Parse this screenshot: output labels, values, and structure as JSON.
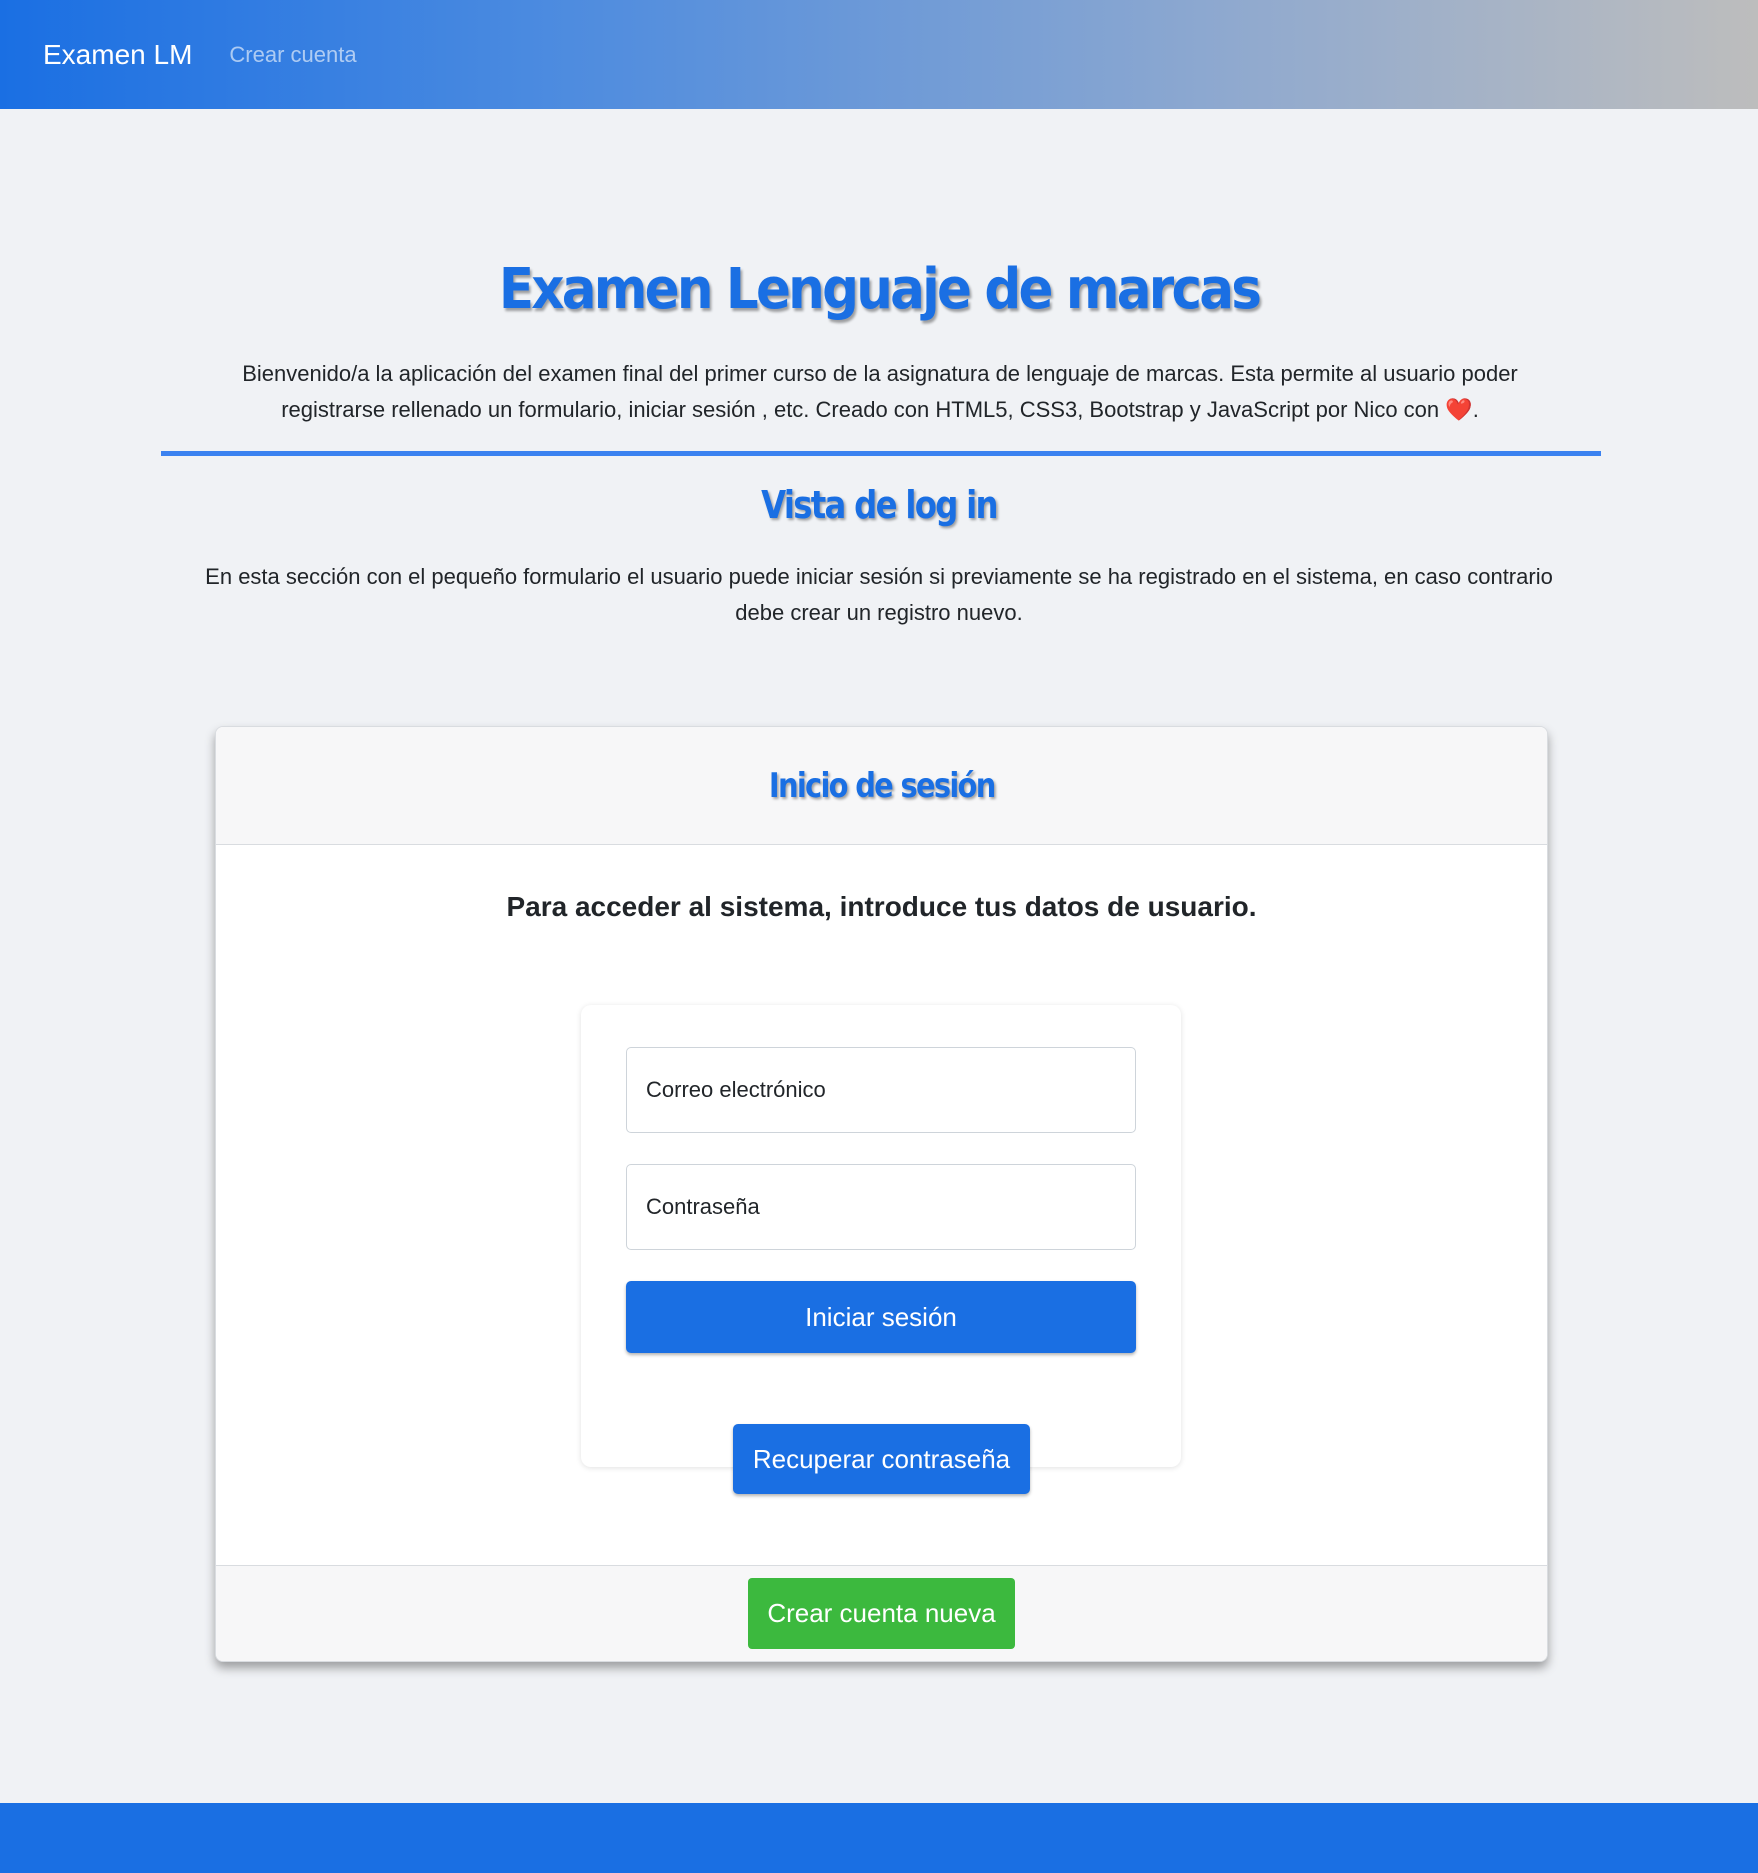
{
  "navbar": {
    "brand": "Examen LM",
    "links": [
      {
        "label": "Crear cuenta"
      }
    ]
  },
  "hero": {
    "title": "Examen Lenguaje de marcas",
    "intro_line1": "Bienvenido/a la aplicación del examen final del primer curso de la asignatura de lenguaje de marcas. Esta permite al usuario poder",
    "intro_line2": "registrarse rellenado un formulario, iniciar sesión , etc. Creado con HTML5, CSS3, Bootstrap y JavaScript por Nico con",
    "heart_icon": "red-heart-emoji",
    "intro_end": "."
  },
  "section": {
    "title": "Vista de log in",
    "description": "En esta sección con el pequeño formulario el usuario puede iniciar sesión si previamente se ha registrado en el sistema, en caso contrario debe crear un registro nuevo."
  },
  "login_card": {
    "title": "Inicio de sesión",
    "lead": "Para acceder al sistema, introduce tus datos de usuario.",
    "email_placeholder": "Correo electrónico",
    "email_value": "",
    "password_placeholder": "Contraseña",
    "password_value": "",
    "login_button": "Iniciar sesión",
    "recover_button": "Recuperar contraseña",
    "create_button": "Crear cuenta nueva"
  },
  "colors": {
    "primary": "#1a6fe3",
    "success": "#3cb93e",
    "background": "#f0f2f5"
  }
}
